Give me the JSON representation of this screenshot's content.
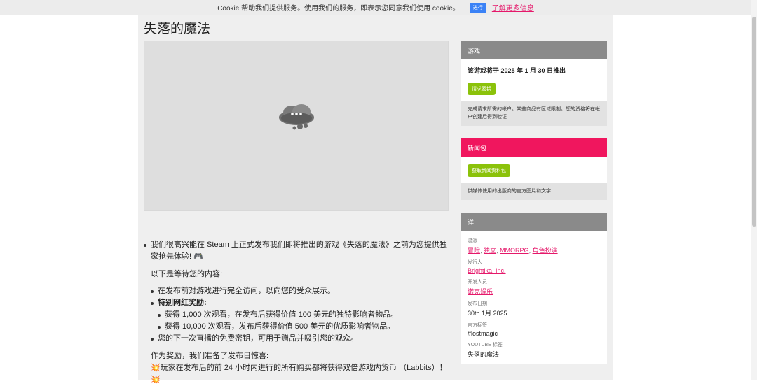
{
  "cookie": {
    "text": "Cookie 帮助我们提供服务。使用我们的服务，即表示您同意我们使用 cookie。",
    "ok_label": "进行",
    "learn_more": "了解更多信息"
  },
  "game": {
    "title": "失落的魔法"
  },
  "content": {
    "intro": "我们很高兴能在 Steam 上正式发布我们即将推出的游戏《失落的魔法》之前为您提供独家抢先体验! 🎮",
    "waiting": "以下是等待您的内容:",
    "item1": "在发布前对游戏进行完全访问，以向您的受众展示。",
    "item2": "特别网红奖励:",
    "sub1": "获得 1,000 次观看，在发布后获得价值 100 美元的独特影响者物品。",
    "sub2": "获得 10,000 次观看，发布后获得价值 500 美元的优质影响者物品。",
    "item3": "您的下一次直播的免费密钥，可用于赠品并吸引您的观众。",
    "reward": "作为奖励，我们准备了发布日惊喜:",
    "bonus": "💥玩家在发布后的前 24 小时内进行的所有购买都将获得双倍游戏内货币 （Labbits）！ 💥"
  },
  "sidebar": {
    "game_box": {
      "header": "游戏",
      "release": "该游戏将于 2025 年 1 月 30 日推出",
      "button": "请求密钥",
      "note": "完成请求所需的帐户。某些商品有区域限制。您的资格将在帐户创建后得到验证"
    },
    "press_box": {
      "header": "新闻包",
      "button": "获取新闻资料包",
      "note": "供媒体使用的出版商的官方图片和文字"
    },
    "details_box": {
      "header": "详",
      "genre_label": "流派",
      "genres": [
        "冒险",
        "独立",
        "MMORPG",
        "角色扮演"
      ],
      "publisher_label": "发行人",
      "publisher": "Brightika, Inc.",
      "developer_label": "开发人员",
      "developer": "诺克娱乐",
      "release_label": "发布日期",
      "release_date": "30th 1月 2025",
      "tags_label": "官方标签",
      "tags": "#lostmagic",
      "youtube_label": "YOUTUBE 标签",
      "youtube_tag": "失落的魔法"
    }
  },
  "colors": {
    "accent_pink": "#f0165e",
    "green": "#8bc20a",
    "header_grey": "#8a8a8a",
    "link": "#e5186a"
  }
}
